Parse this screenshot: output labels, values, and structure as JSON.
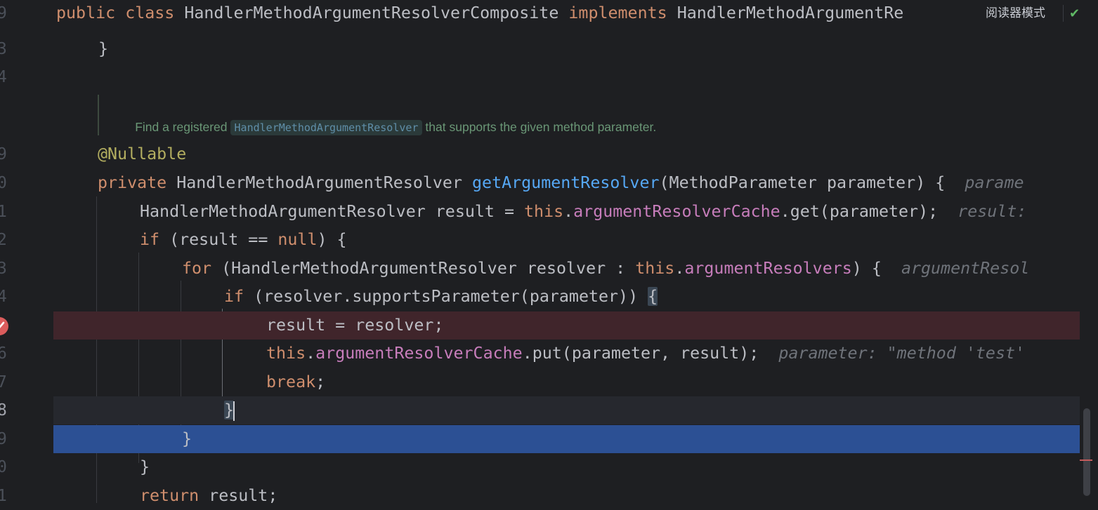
{
  "header": {
    "line_number": "9",
    "code": "public class HandlerMethodArgumentResolverComposite implements HandlerMethodArgumentRe",
    "keyword_public": "public",
    "keyword_class": "class",
    "class_name": "HandlerMethodArgumentResolverComposite",
    "keyword_implements": "implements",
    "interface_name": "HandlerMethodArgumentRe",
    "reader_mode_label": "阅读器模式"
  },
  "gutter": {
    "line_numbers": [
      "3",
      "4",
      "9",
      "0",
      "1",
      "2",
      "3",
      "4",
      "5",
      "6",
      "7",
      "8",
      "9",
      "0",
      "1"
    ]
  },
  "doc_comment": {
    "prefix": "Find a registered",
    "code_ref": "HandlerMethodArgumentResolver",
    "suffix": "that supports the given method parameter."
  },
  "code": {
    "line_closing_brace": "}",
    "annotation": "@Nullable",
    "sig_private": "private",
    "sig_type": "HandlerMethodArgumentResolver",
    "sig_method": "getArgumentResolver",
    "sig_params": "(MethodParameter parameter) {",
    "sig_hint": "parame",
    "l1_type": "HandlerMethodArgumentResolver result = ",
    "l1_this": "this",
    "l1_dot": ".",
    "l1_field": "argumentResolverCache",
    "l1_rest": ".get(parameter);",
    "l1_hint": "result:",
    "l2_if": "if",
    "l2_mid": " (result == ",
    "l2_null": "null",
    "l2_end": ") {",
    "l3_for": "for",
    "l3_mid": " (HandlerMethodArgumentResolver resolver : ",
    "l3_this": "this",
    "l3_dot": ".",
    "l3_field": "argumentResolvers",
    "l3_end": ") {",
    "l3_hint": "argumentResol",
    "l4_if": "if",
    "l4_rest": " (resolver.supportsParameter(parameter)) ",
    "l4_brace": "{",
    "l5_code": "result = resolver;",
    "l6_this": "this",
    "l6_dot": ".",
    "l6_field": "argumentResolverCache",
    "l6_rest": ".put(parameter, result);",
    "l6_hint": "parameter: \"method 'test'",
    "l7_break": "break",
    "l7_semi": ";",
    "l8_brace": "}",
    "l9_brace": "}",
    "l10_brace": "}",
    "l11_return": "return",
    "l11_rest": " result;"
  },
  "colors": {
    "background": "#1e1f22",
    "keyword": "#cf8e6d",
    "method": "#56a8f5",
    "field": "#c77dbb",
    "annotation": "#b3ae60",
    "breakpoint_line": "#40252b",
    "selection_line": "#2c5094",
    "doc_text": "#6a9776"
  },
  "icons": [
    "breakpoint-icon",
    "check-icon"
  ]
}
